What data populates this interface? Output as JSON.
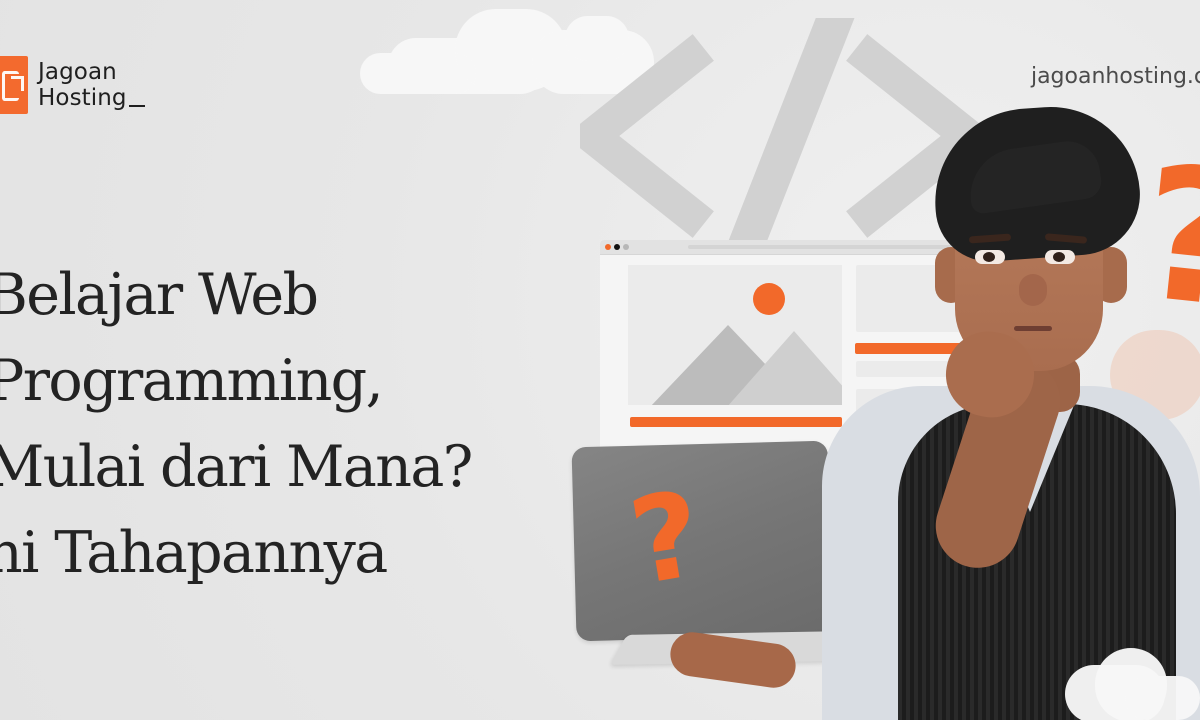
{
  "brand": {
    "logo_line1": "Jagoan",
    "logo_line2": "Hosting",
    "website": "jagoanhosting.c"
  },
  "headline": {
    "line1": "Belajar Web",
    "line2": "Programming,",
    "line3": "Mulai dari Mana?",
    "line4": "ni Tahapannya"
  },
  "graphics": {
    "code_symbol": "code-brackets-icon",
    "question_marks": [
      "?",
      "?"
    ],
    "question_mark_icon": "question-mark-icon",
    "browser_mockup": "website-wireframe-icon",
    "image_placeholder": "landscape-image-icon",
    "laptop": "laptop-icon"
  },
  "colors": {
    "accent": "#f2692a",
    "background": "#e8e8e8",
    "text": "#232323",
    "muted_shape": "#cecece"
  }
}
